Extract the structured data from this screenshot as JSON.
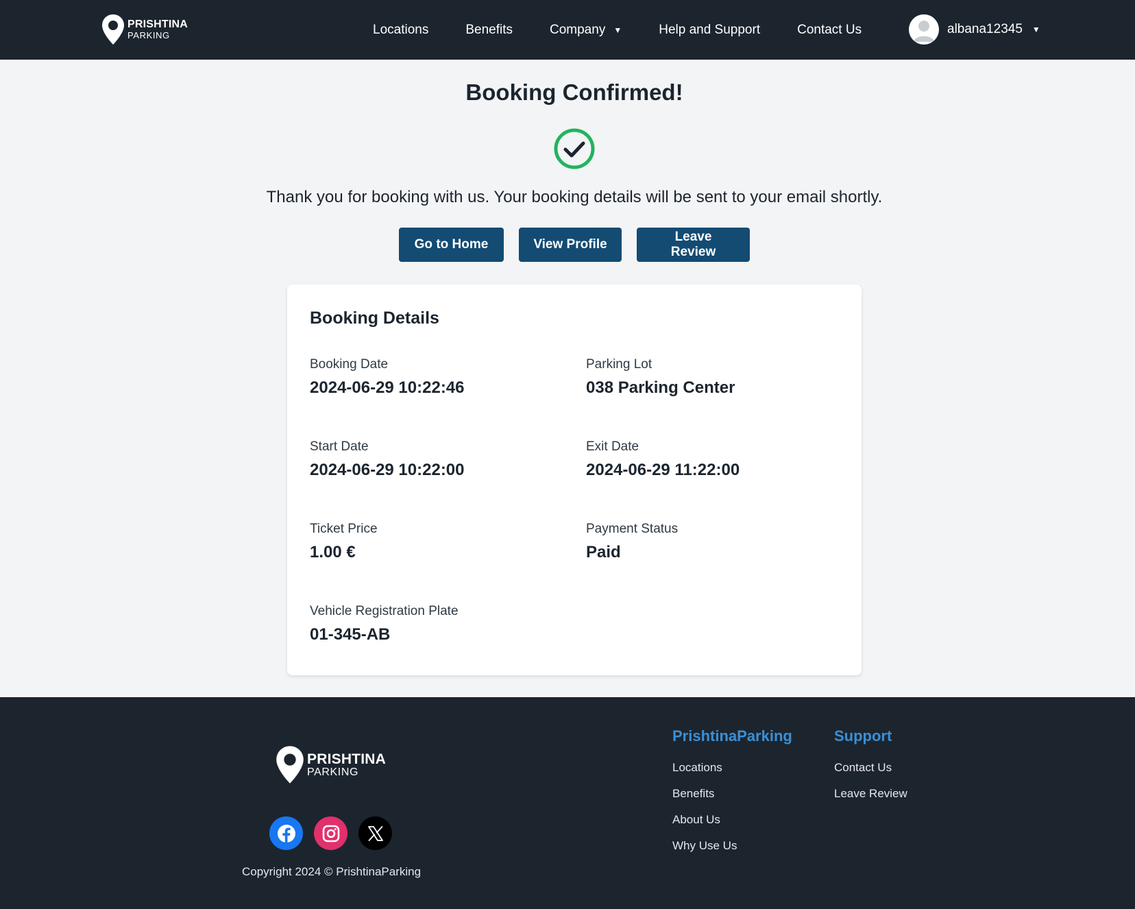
{
  "brand": {
    "name_line1": "PRISHTINA",
    "name_line2": "PARKING"
  },
  "nav": {
    "links": [
      {
        "label": "Locations"
      },
      {
        "label": "Benefits"
      },
      {
        "label": "Company"
      },
      {
        "label": "Help and Support"
      },
      {
        "label": "Contact Us"
      }
    ],
    "username": "albana12345"
  },
  "confirmation": {
    "title": "Booking Confirmed!",
    "message": "Thank you for booking with us. Your booking details will be sent to your email shortly.",
    "buttons": {
      "home": "Go to Home",
      "profile": "View Profile",
      "review": "Leave Review"
    }
  },
  "booking": {
    "title": "Booking Details",
    "fields": {
      "booking_date": {
        "label": "Booking Date",
        "value": "2024-06-29 10:22:46"
      },
      "parking_lot": {
        "label": "Parking Lot",
        "value": "038 Parking Center"
      },
      "start_date": {
        "label": "Start Date",
        "value": "2024-06-29 10:22:00"
      },
      "exit_date": {
        "label": "Exit Date",
        "value": "2024-06-29 11:22:00"
      },
      "ticket_price": {
        "label": "Ticket Price",
        "value": "1.00 €"
      },
      "payment_status": {
        "label": "Payment Status",
        "value": "Paid"
      },
      "plate": {
        "label": "Vehicle Registration Plate",
        "value": "01-345-AB"
      }
    }
  },
  "footer": {
    "copyright": "Copyright 2024 © PrishtinaParking",
    "col1": {
      "heading": "PrishtinaParking",
      "links": [
        "Locations",
        "Benefits",
        "About Us",
        "Why Use Us"
      ]
    },
    "col2": {
      "heading": "Support",
      "links": [
        "Contact Us",
        "Leave Review"
      ]
    }
  },
  "icons": {
    "check": "check-circle-icon",
    "facebook": "facebook-icon",
    "instagram": "instagram-icon",
    "x": "x-icon"
  },
  "colors": {
    "navbar": "#1c252e",
    "button": "#134b73",
    "success": "#22b35e",
    "footer_heading": "#3b8fd6"
  }
}
